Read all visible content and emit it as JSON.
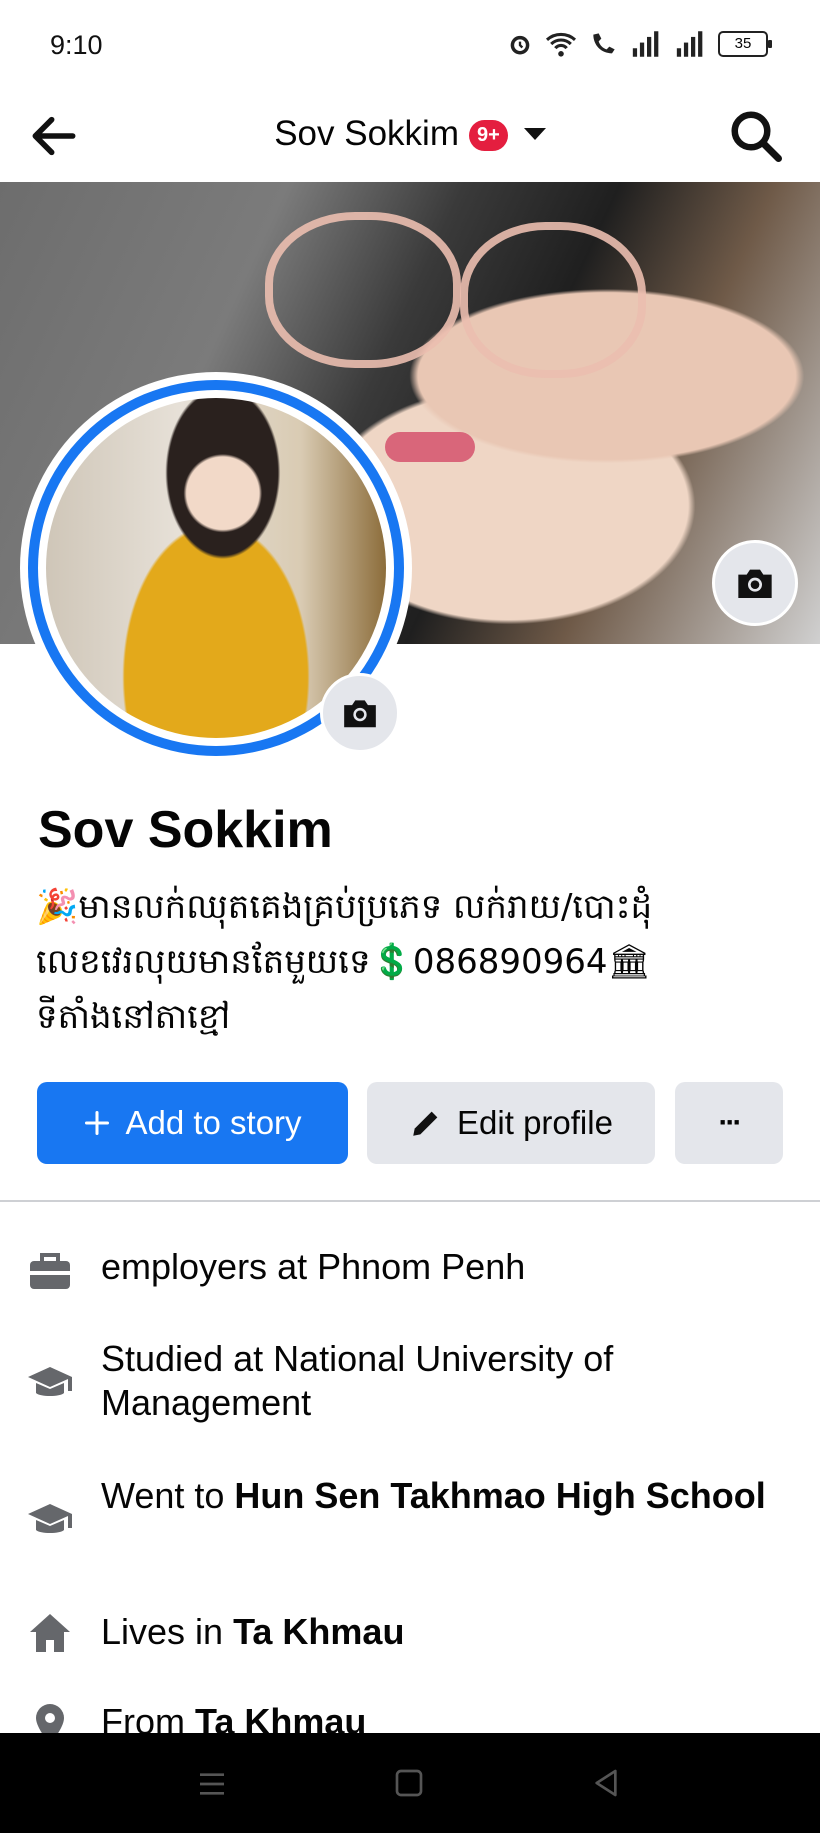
{
  "status_bar": {
    "time": "9:10",
    "battery": "35"
  },
  "nav": {
    "title": "Sov Sokkim",
    "badge": "9+"
  },
  "profile": {
    "name": "Sov Sokkim",
    "bio_line1": "🎉មានលក់ឈុតគេងគ្រប់ប្រភេទ លក់រាយ/បោះដុំ",
    "bio_line2": "លេខវេរលុយមានតែមួយទេ💲086890964🏛",
    "bio_line3": "ទីតាំងនៅតាខ្មៅ"
  },
  "actions": {
    "add_story": "Add to story",
    "edit_profile": "Edit profile",
    "more": "···"
  },
  "details": [
    {
      "icon": "briefcase-icon",
      "prefix": "employers at Phnom Penh",
      "bold": ""
    },
    {
      "icon": "graduation-cap-icon",
      "prefix": "Studied at National University of Management",
      "bold": ""
    },
    {
      "icon": "graduation-cap-icon",
      "prefix": "Went to ",
      "bold": "Hun Sen Takhmao High School"
    },
    {
      "icon": "home-icon",
      "prefix": "Lives in ",
      "bold": "Ta Khmau"
    },
    {
      "icon": "location-pin-icon",
      "prefix": "From ",
      "bold": "Ta Khmau"
    }
  ],
  "colors": {
    "accent": "#1877f2",
    "button_gray": "#e4e6eb",
    "badge_red": "#e41e3f"
  }
}
